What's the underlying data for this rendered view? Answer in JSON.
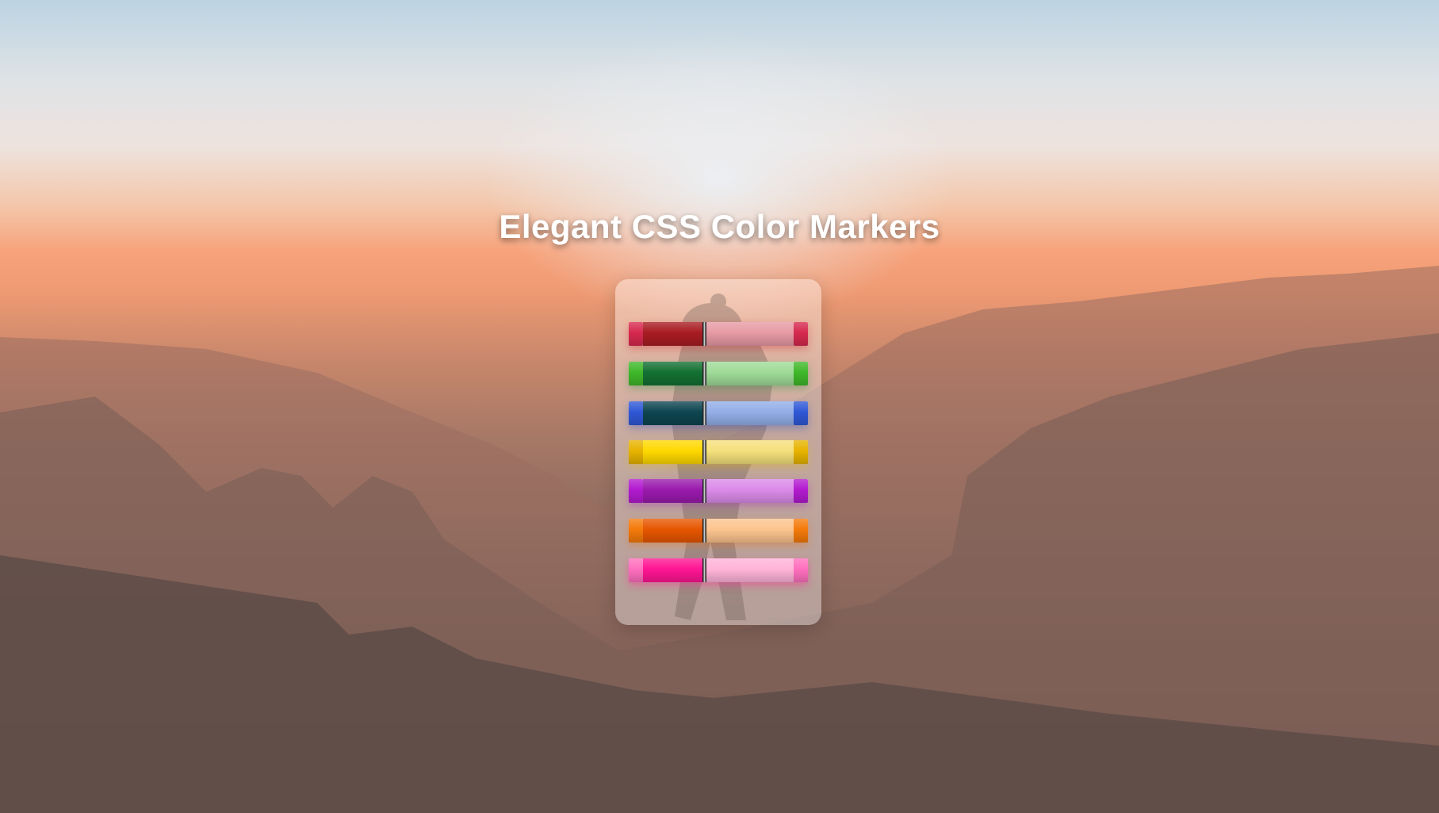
{
  "page": {
    "title": "Elegant CSS Color Markers"
  },
  "markers": [
    {
      "color": "red",
      "cap": "#d6294f",
      "body": "#a81c22",
      "tail": "#e79aa4",
      "glow": "rgba(200,30,40,0.35)"
    },
    {
      "color": "green",
      "cap": "#3fb829",
      "body": "#137032",
      "tail": "#9fdb98",
      "glow": "rgba(30,140,60,0.35)"
    },
    {
      "color": "blue",
      "cap": "#2f58d6",
      "body": "#0d4550",
      "tail": "#93aee8",
      "glow": "rgba(30,70,200,0.35)"
    },
    {
      "color": "yellow",
      "cap": "#e7b300",
      "body": "#ffd800",
      "tail": "#f5e07c",
      "glow": "rgba(230,190,0,0.35)"
    },
    {
      "color": "purple",
      "cap": "#b21acf",
      "body": "#9a1aad",
      "tail": "#db8be9",
      "glow": "rgba(160,30,190,0.35)"
    },
    {
      "color": "orange",
      "cap": "#f47a0a",
      "body": "#e65600",
      "tail": "#fcc48e",
      "glow": "rgba(240,110,10,0.35)"
    },
    {
      "color": "pink",
      "cap": "#ff6fbe",
      "body": "#ff1593",
      "tail": "#ffb3d8",
      "glow": "rgba(255,40,150,0.45)"
    }
  ]
}
